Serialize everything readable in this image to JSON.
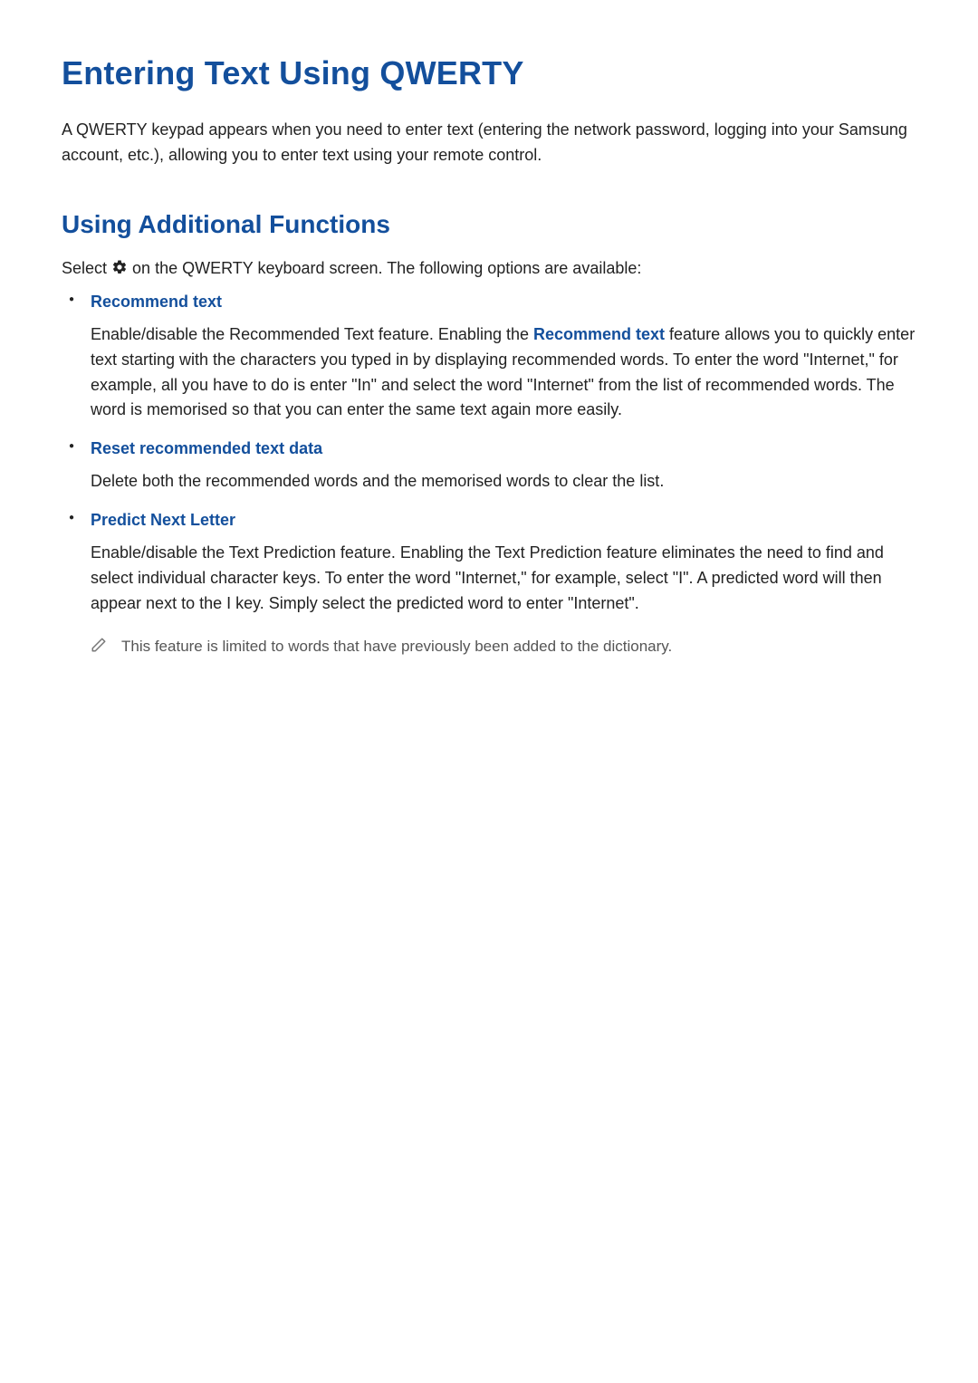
{
  "title": "Entering Text Using QWERTY",
  "intro": "A QWERTY keypad appears when you need to enter text (entering the network password, logging into your Samsung account, etc.), allowing you to enter text using your remote control.",
  "section": {
    "heading": "Using Additional Functions",
    "select_prefix": "Select ",
    "select_suffix": " on the QWERTY keyboard screen. The following options are available:",
    "items": [
      {
        "name": "Recommend text",
        "body_before": "Enable/disable the Recommended Text feature. Enabling the ",
        "body_emph": "Recommend text",
        "body_after": " feature allows you to quickly enter text starting with the characters you typed in by displaying recommended words. To enter the word \"Internet,\" for example, all you have to do is enter \"In\" and select the word \"Internet\" from the list of recommended words. The word is memorised so that you can enter the same text again more easily."
      },
      {
        "name": "Reset recommended text data",
        "body": "Delete both the recommended words and the memorised words to clear the list."
      },
      {
        "name": "Predict Next Letter",
        "body": "Enable/disable the Text Prediction feature. Enabling the Text Prediction feature eliminates the need to find and select individual character keys. To enter the word \"Internet,\" for example, select \"I\". A predicted word will then appear next to the I key. Simply select the predicted word to enter \"Internet\".",
        "note": "This feature is limited to words that have previously been added to the dictionary."
      }
    ]
  }
}
